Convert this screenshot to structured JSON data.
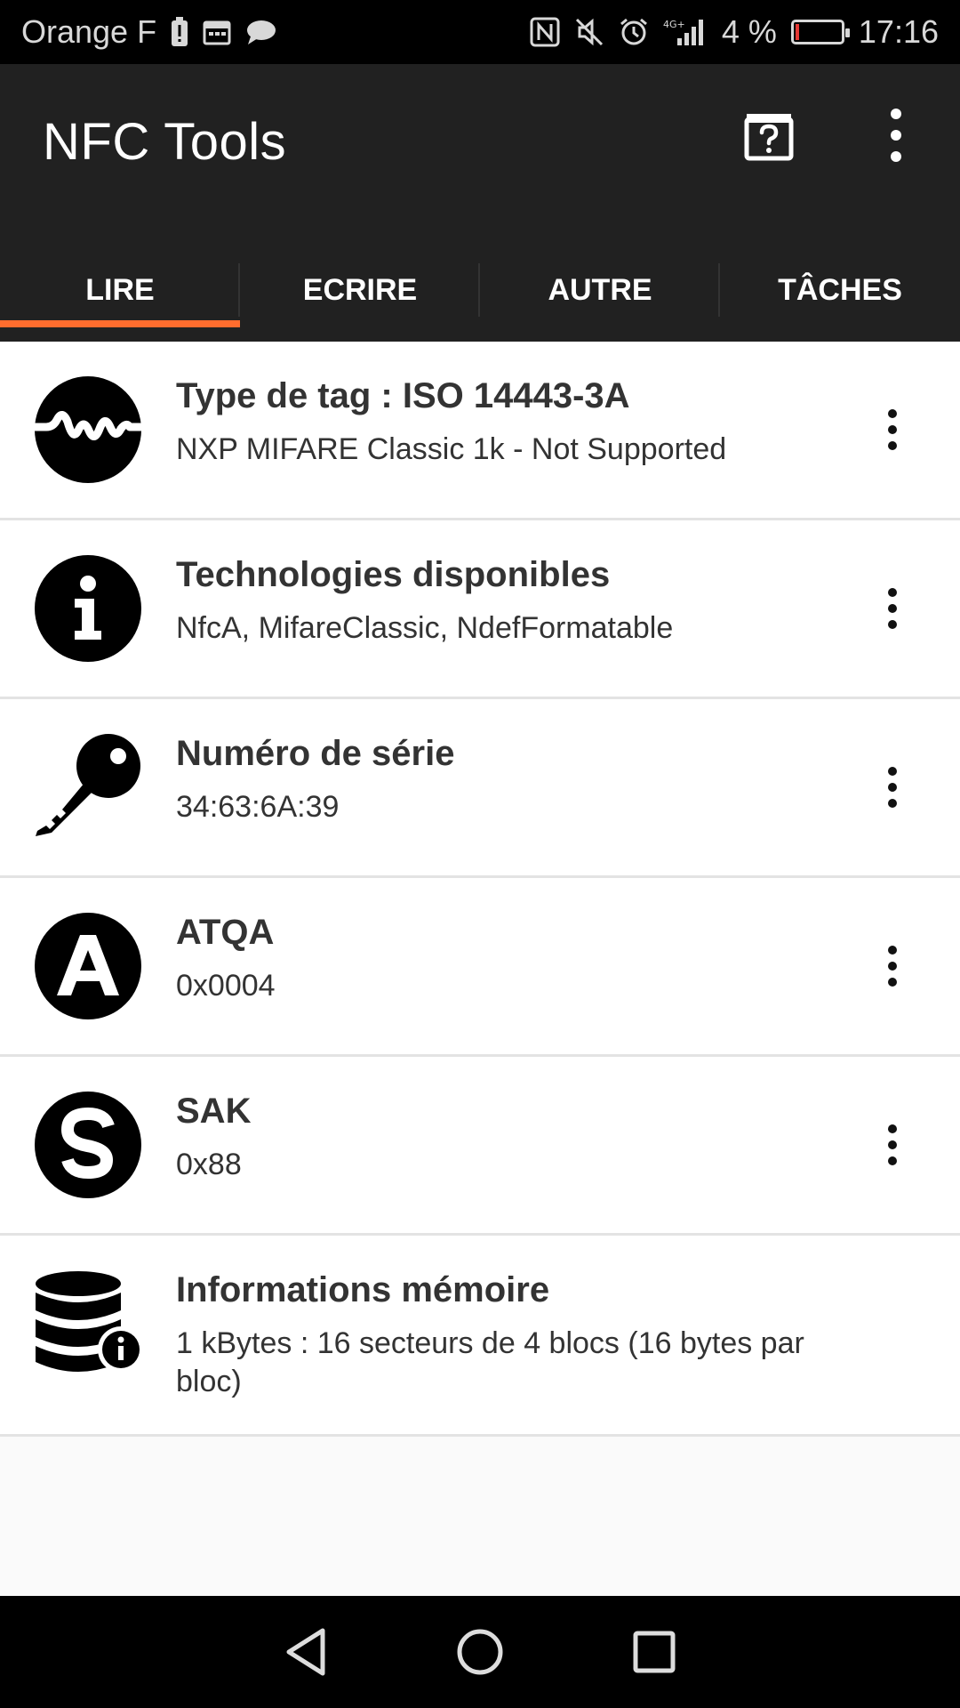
{
  "status_bar": {
    "carrier": "Orange F",
    "battery_percent": "4 %",
    "time": "17:16",
    "network_label": "4G+",
    "battery_level": 0.04,
    "battery_color": "#e53935"
  },
  "app": {
    "title": "NFC Tools",
    "accent_color": "#ff6d2e",
    "toolbar_color": "#212121"
  },
  "tabs": [
    {
      "label": "LIRE",
      "active": true
    },
    {
      "label": "ECRIRE",
      "active": false
    },
    {
      "label": "AUTRE",
      "active": false
    },
    {
      "label": "TÂCHES",
      "active": false
    }
  ],
  "items": [
    {
      "icon": "wave-signal-icon",
      "title": "Type de tag : ISO 14443-3A",
      "subtitle": "NXP MIFARE Classic 1k - Not Supported"
    },
    {
      "icon": "info-icon",
      "title": "Technologies disponibles",
      "subtitle": "NfcA, MifareClassic, NdefFormatable"
    },
    {
      "icon": "key-icon",
      "title": "Numéro de série",
      "subtitle": "34:63:6A:39"
    },
    {
      "icon": "letter-a-icon",
      "title": "ATQA",
      "subtitle": "0x0004"
    },
    {
      "icon": "letter-s-icon",
      "title": "SAK",
      "subtitle": "0x88"
    },
    {
      "icon": "database-info-icon",
      "title": "Informations mémoire",
      "subtitle": "1 kBytes : 16 secteurs de 4 blocs (16 bytes par bloc)"
    }
  ]
}
